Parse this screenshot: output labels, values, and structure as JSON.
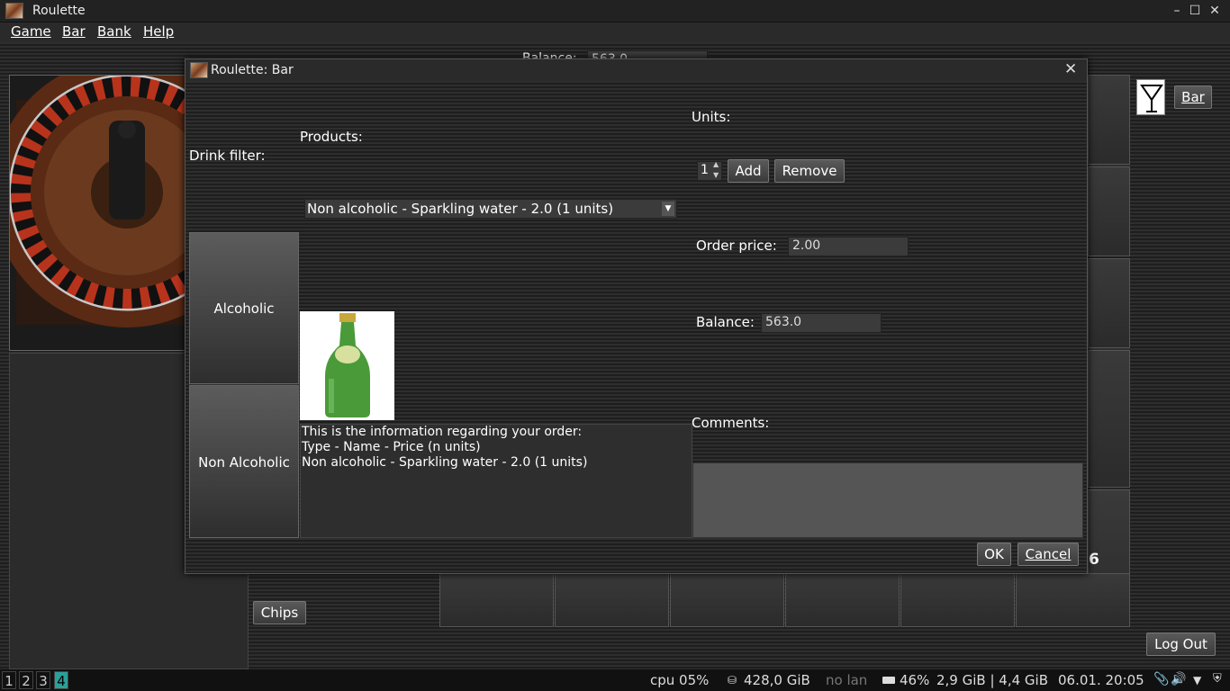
{
  "window": {
    "title": "Roulette"
  },
  "menu": [
    "Game",
    "Bar",
    "Bank",
    "Help"
  ],
  "main": {
    "balance_label": "Balance:",
    "balance_value": "563.0",
    "bar_button": "Bar",
    "chips_button": "Chips",
    "logout_button": "Log Out",
    "table_number_fragment": "6"
  },
  "dialog": {
    "title": "Roulette: Bar",
    "drink_filter_label": "Drink filter:",
    "products_label": "Products:",
    "units_label": "Units:",
    "units_value": "1",
    "add_button": "Add",
    "remove_button": "Remove",
    "product_selected": "Non alcoholic - Sparkling water - 2.0 (1 units)",
    "alcoholic_button": "Alcoholic",
    "non_alcoholic_button": "Non Alcoholic",
    "order_price_label": "Order price:",
    "order_price_value": "2.00",
    "balance_label": "Balance:",
    "balance_value": "563.0",
    "order_info_lines": [
      "This is the information regarding your order:",
      "Type - Name - Price (n units)",
      "Non alcoholic - Sparkling water - 2.0 (1 units)"
    ],
    "comments_label": "Comments:",
    "comments_value": "",
    "ok_button": "OK",
    "cancel_button": "Cancel"
  },
  "taskbar": {
    "workspaces": [
      "1",
      "2",
      "3",
      "4"
    ],
    "active_workspace": "4",
    "cpu": "cpu  05%",
    "disk": "428,0 GiB",
    "network": "no lan",
    "battery": "46%",
    "memory": "2,9 GiB | 4,4 GiB",
    "datetime": "06.01. 20:05"
  },
  "colors": {
    "accent": "#2aa198",
    "panel": "#2b2b2b"
  }
}
